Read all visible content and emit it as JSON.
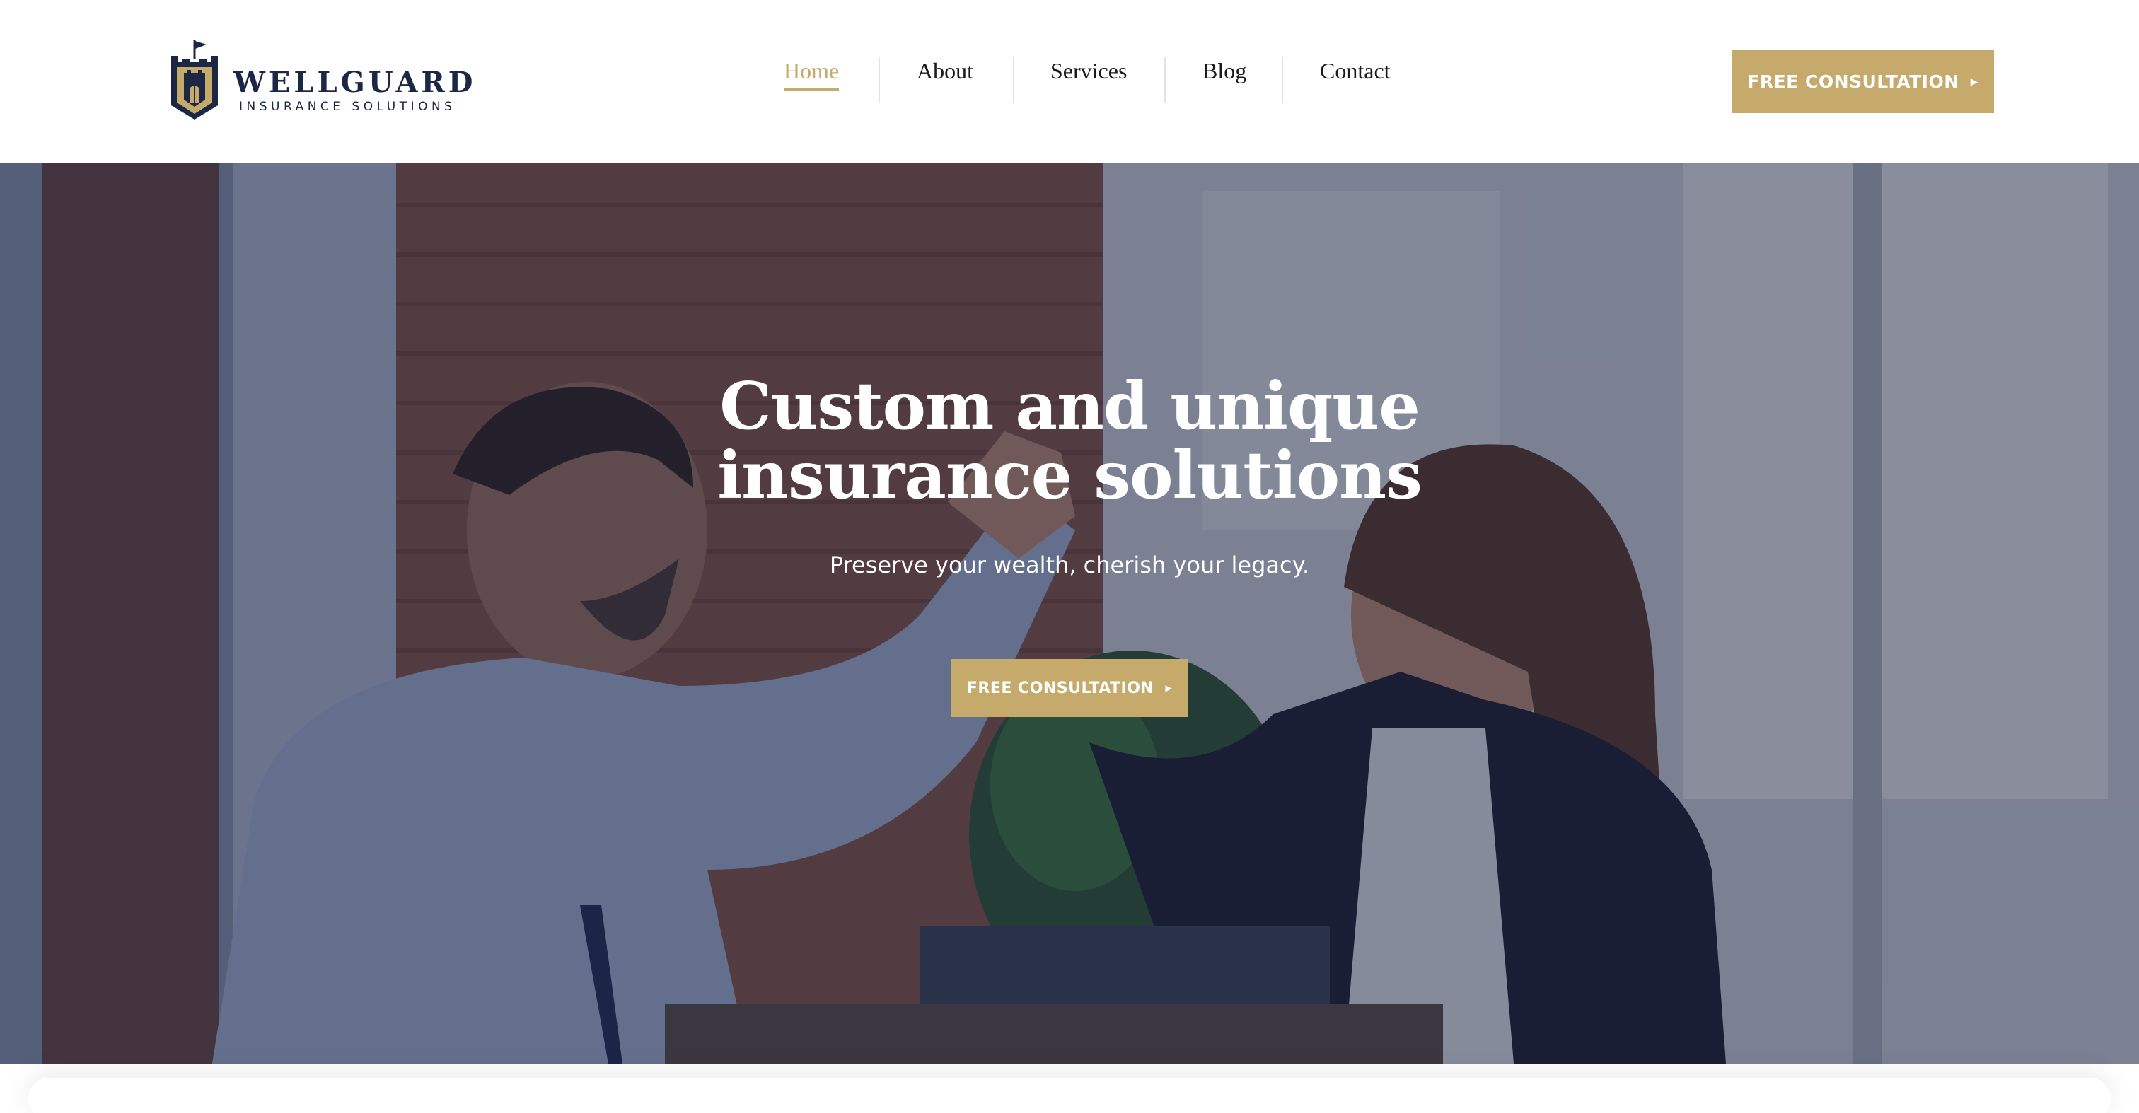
{
  "brand": {
    "name": "WELLGUARD",
    "tagline": "INSURANCE SOLUTIONS",
    "logo_icon": "shield-castle-icon",
    "navy": "#1c2745",
    "gold": "#c6aa6b"
  },
  "nav": {
    "items": [
      {
        "label": "Home",
        "active": true
      },
      {
        "label": "About",
        "active": false
      },
      {
        "label": "Services",
        "active": false
      },
      {
        "label": "Blog",
        "active": false
      },
      {
        "label": "Contact",
        "active": false
      }
    ],
    "cta_label": "FREE CONSULTATION",
    "cta_icon": "caret-right-icon"
  },
  "hero": {
    "title_line1": "Custom and unique",
    "title_line2": "insurance solutions",
    "subtitle": "Preserve your wealth, cherish your legacy.",
    "cta_label": "FREE CONSULTATION",
    "cta_icon": "caret-right-icon",
    "background_image": "office-high-five-photo"
  }
}
